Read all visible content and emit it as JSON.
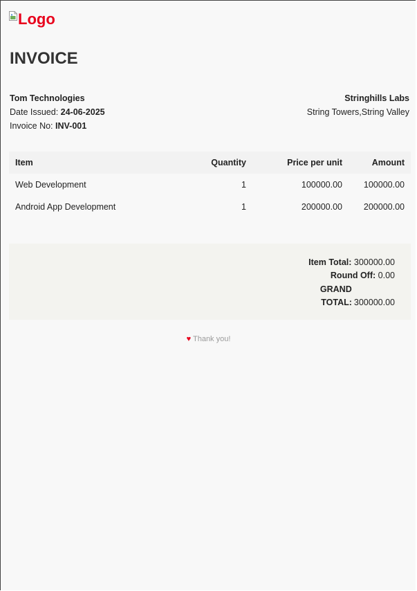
{
  "logo": {
    "alt_text": "Logo"
  },
  "title": "INVOICE",
  "from": {
    "company": "Tom Technologies",
    "date_label": "Date Issued: ",
    "date_value": "24-06-2025",
    "invoice_label": "Invoice No: ",
    "invoice_value": "INV-001"
  },
  "to": {
    "company": "Stringhills Labs",
    "address": "String Towers,String Valley"
  },
  "table": {
    "headers": {
      "item": "Item",
      "quantity": "Quantity",
      "price": "Price per unit",
      "amount": "Amount"
    },
    "rows": [
      {
        "item": "Web Development",
        "quantity": "1",
        "price": "100000.00",
        "amount": "100000.00"
      },
      {
        "item": "Android App Development",
        "quantity": "1",
        "price": "200000.00",
        "amount": "200000.00"
      }
    ]
  },
  "totals": {
    "item_total_label": "Item Total:",
    "item_total_value": "300000.00",
    "round_off_label": "Round Off:",
    "round_off_value": "0.00",
    "grand_label_1": "GRAND",
    "grand_label_2": "TOTAL:",
    "grand_value": "300000.00"
  },
  "footer": {
    "icon": "heart-icon",
    "text": "Thank you!"
  },
  "colors": {
    "brand_red": "#e8001c",
    "page_bg": "#f8f8f8",
    "totals_bg": "#f3f3ef"
  }
}
